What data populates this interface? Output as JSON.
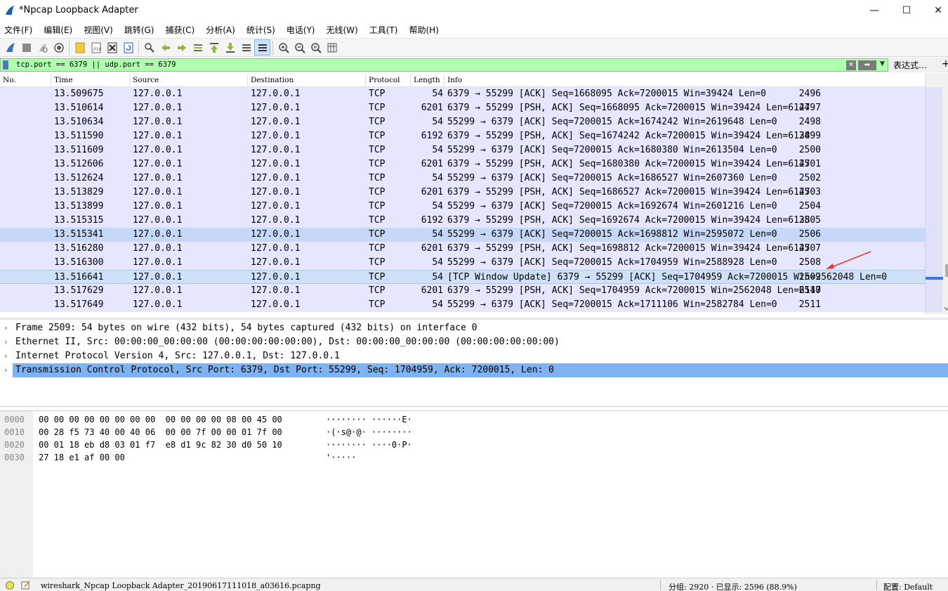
{
  "window": {
    "title": "*Npcap Loopback Adapter",
    "minimize": "—",
    "maximize": "☐",
    "close": "✕"
  },
  "menu": [
    "文件(F)",
    "编辑(E)",
    "视图(V)",
    "跳转(G)",
    "捕获(C)",
    "分析(A)",
    "统计(S)",
    "电话(Y)",
    "无线(W)",
    "工具(T)",
    "帮助(H)"
  ],
  "toolbar": {
    "icons": [
      "shark-start-icon",
      "stop-icon",
      "restart-icon",
      "capture-options-icon",
      "open-file-icon",
      "save-file-icon",
      "close-file-icon",
      "reload-icon",
      "find-packet-icon",
      "go-back-icon",
      "go-forward-icon",
      "go-to-packet-icon",
      "go-first-icon",
      "go-last-icon",
      "autoscroll-icon",
      "colorize-icon",
      "zoom-in-icon",
      "zoom-out-icon",
      "zoom-normal-icon",
      "resize-columns-icon"
    ]
  },
  "filter": {
    "value": "tcp.port == 6379 || udp.port == 6379",
    "expression_label": "表达式…",
    "plus_label": "+"
  },
  "columns": {
    "no": "No.",
    "time": "Time",
    "source": "Source",
    "destination": "Destination",
    "protocol": "Protocol",
    "length": "Length",
    "info": "Info"
  },
  "packets": [
    {
      "no": "2496",
      "time": "13.509675",
      "src": "127.0.0.1",
      "dst": "127.0.0.1",
      "proto": "TCP",
      "len": "54",
      "info": "6379 → 55299 [ACK] Seq=1668095 Ack=7200015 Win=39424 Len=0"
    },
    {
      "no": "2497",
      "time": "13.510614",
      "src": "127.0.0.1",
      "dst": "127.0.0.1",
      "proto": "TCP",
      "len": "6201",
      "info": "6379 → 55299 [PSH, ACK] Seq=1668095 Ack=7200015 Win=39424 Len=6147"
    },
    {
      "no": "2498",
      "time": "13.510634",
      "src": "127.0.0.1",
      "dst": "127.0.0.1",
      "proto": "TCP",
      "len": "54",
      "info": "55299 → 6379 [ACK] Seq=7200015 Ack=1674242 Win=2619648 Len=0"
    },
    {
      "no": "2499",
      "time": "13.511590",
      "src": "127.0.0.1",
      "dst": "127.0.0.1",
      "proto": "TCP",
      "len": "6192",
      "info": "6379 → 55299 [PSH, ACK] Seq=1674242 Ack=7200015 Win=39424 Len=6138"
    },
    {
      "no": "2500",
      "time": "13.511609",
      "src": "127.0.0.1",
      "dst": "127.0.0.1",
      "proto": "TCP",
      "len": "54",
      "info": "55299 → 6379 [ACK] Seq=7200015 Ack=1680380 Win=2613504 Len=0"
    },
    {
      "no": "2501",
      "time": "13.512606",
      "src": "127.0.0.1",
      "dst": "127.0.0.1",
      "proto": "TCP",
      "len": "6201",
      "info": "6379 → 55299 [PSH, ACK] Seq=1680380 Ack=7200015 Win=39424 Len=6147"
    },
    {
      "no": "2502",
      "time": "13.512624",
      "src": "127.0.0.1",
      "dst": "127.0.0.1",
      "proto": "TCP",
      "len": "54",
      "info": "55299 → 6379 [ACK] Seq=7200015 Ack=1686527 Win=2607360 Len=0"
    },
    {
      "no": "2503",
      "time": "13.513829",
      "src": "127.0.0.1",
      "dst": "127.0.0.1",
      "proto": "TCP",
      "len": "6201",
      "info": "6379 → 55299 [PSH, ACK] Seq=1686527 Ack=7200015 Win=39424 Len=6147"
    },
    {
      "no": "2504",
      "time": "13.513899",
      "src": "127.0.0.1",
      "dst": "127.0.0.1",
      "proto": "TCP",
      "len": "54",
      "info": "55299 → 6379 [ACK] Seq=7200015 Ack=1692674 Win=2601216 Len=0"
    },
    {
      "no": "2505",
      "time": "13.515315",
      "src": "127.0.0.1",
      "dst": "127.0.0.1",
      "proto": "TCP",
      "len": "6192",
      "info": "6379 → 55299 [PSH, ACK] Seq=1692674 Ack=7200015 Win=39424 Len=6138"
    },
    {
      "no": "2506",
      "time": "13.515341",
      "src": "127.0.0.1",
      "dst": "127.0.0.1",
      "proto": "TCP",
      "len": "54",
      "info": "55299 → 6379 [ACK] Seq=7200015 Ack=1698812 Win=2595072 Len=0"
    },
    {
      "no": "2507",
      "time": "13.516280",
      "src": "127.0.0.1",
      "dst": "127.0.0.1",
      "proto": "TCP",
      "len": "6201",
      "info": "6379 → 55299 [PSH, ACK] Seq=1698812 Ack=7200015 Win=39424 Len=6147"
    },
    {
      "no": "2508",
      "time": "13.516300",
      "src": "127.0.0.1",
      "dst": "127.0.0.1",
      "proto": "TCP",
      "len": "54",
      "info": "55299 → 6379 [ACK] Seq=7200015 Ack=1704959 Win=2588928 Len=0"
    },
    {
      "no": "2509",
      "time": "13.516641",
      "src": "127.0.0.1",
      "dst": "127.0.0.1",
      "proto": "TCP",
      "len": "54",
      "info": "[TCP Window Update] 6379 → 55299 [ACK] Seq=1704959 Ack=7200015 Win=2562048 Len=0"
    },
    {
      "no": "2510",
      "time": "13.517629",
      "src": "127.0.0.1",
      "dst": "127.0.0.1",
      "proto": "TCP",
      "len": "6201",
      "info": "6379 → 55299 [PSH, ACK] Seq=1704959 Ack=7200015 Win=2562048 Len=6147"
    },
    {
      "no": "2511",
      "time": "13.517649",
      "src": "127.0.0.1",
      "dst": "127.0.0.1",
      "proto": "TCP",
      "len": "54",
      "info": "55299 → 6379 [ACK] Seq=7200015 Ack=1711106 Win=2582784 Len=0"
    }
  ],
  "selected_packet": "2509",
  "details": [
    "Frame 2509: 54 bytes on wire (432 bits), 54 bytes captured (432 bits) on interface 0",
    "Ethernet II, Src: 00:00:00_00:00:00 (00:00:00:00:00:00), Dst: 00:00:00_00:00:00 (00:00:00:00:00:00)",
    "Internet Protocol Version 4, Src: 127.0.0.1, Dst: 127.0.0.1",
    "Transmission Control Protocol, Src Port: 6379, Dst Port: 55299, Seq: 1704959, Ack: 7200015, Len: 0"
  ],
  "bytes": [
    {
      "offset": "0000",
      "hex": "00 00 00 00 00 00 00 00  00 00 00 00 08 00 45 00",
      "ascii": "········ ······E·"
    },
    {
      "offset": "0010",
      "hex": "00 28 f5 73 40 00 40 06  00 00 7f 00 00 01 7f 00",
      "ascii": "·(·s@·@· ········"
    },
    {
      "offset": "0020",
      "hex": "00 01 18 eb d8 03 01 f7  e8 d1 9c 82 30 d0 50 10",
      "ascii": "········ ····0·P·"
    },
    {
      "offset": "0030",
      "hex": "27 18 e1 af 00 00",
      "ascii": "'·····"
    }
  ],
  "status": {
    "file": "wireshark_Npcap Loopback Adapter_20190617111018_a03616.pcapng",
    "stats": "分组: 2920 · 已显示: 2596 (88.9%)",
    "profile": "配置: Default"
  },
  "colors": {
    "filter_ok": "#afffaf",
    "row_bg": "#e7e6ff",
    "selected_detail": "#7fb2f0",
    "annotation_arrow": "#e53935"
  }
}
